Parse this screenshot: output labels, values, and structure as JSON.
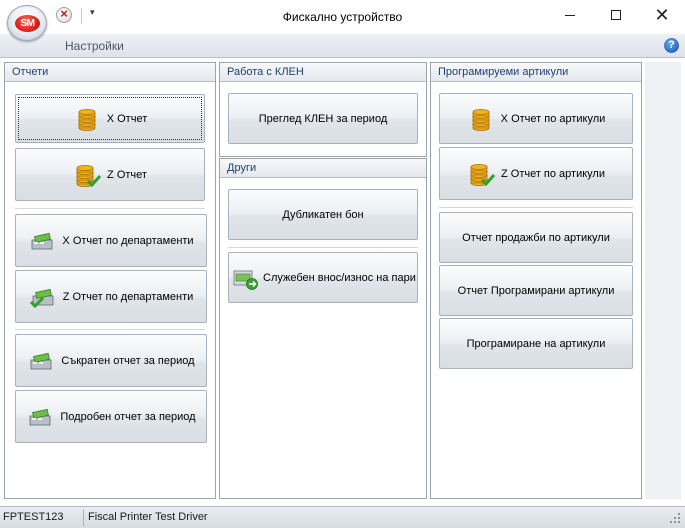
{
  "window": {
    "title": "Фискално устройство",
    "app_logo_text": "SM",
    "minimize_glyph": "",
    "close_glyph": "✕"
  },
  "ribbon": {
    "tab_label": "Настройки",
    "help_glyph": "?"
  },
  "panels": {
    "reports": {
      "title": "Отчети",
      "buttons": [
        {
          "label": "X Отчет",
          "icon": "coins-stack-icon"
        },
        {
          "label": "Z Отчет",
          "icon": "coins-stack-check-icon"
        },
        {
          "label": "X Отчет по департаменти",
          "icon": "cash-register-icon"
        },
        {
          "label": "Z Отчет по департаменти",
          "icon": "cash-register-check-icon"
        },
        {
          "label": "Съкратен отчет за период",
          "icon": "cash-register-icon"
        },
        {
          "label": "Подробен отчет за период",
          "icon": "cash-register-icon"
        }
      ]
    },
    "klen": {
      "title": "Работа с КЛЕН",
      "buttons": [
        {
          "label": "Преглед КЛЕН за период"
        }
      ]
    },
    "other": {
      "title": "Други",
      "buttons": [
        {
          "label": "Дубликатен бон"
        },
        {
          "label": "Служебен внос/износ на пари",
          "icon": "cash-transfer-icon"
        }
      ]
    },
    "articles": {
      "title": "Програмируеми артикули",
      "buttons": [
        {
          "label": "X Отчет по артикули",
          "icon": "coins-stack-icon"
        },
        {
          "label": "Z Отчет по артикули",
          "icon": "coins-stack-check-icon"
        },
        {
          "label": "Отчет продажби по артикули"
        },
        {
          "label": "Отчет Програмирани артикули"
        },
        {
          "label": "Програмиране на артикули"
        }
      ]
    }
  },
  "statusbar": {
    "device_code": "FPTEST123",
    "driver_name": "Fiscal Printer Test Driver"
  },
  "colors": {
    "accent": "#1e3f76",
    "panel_border": "#9aa4ae",
    "button_border": "#a9b1ba"
  }
}
